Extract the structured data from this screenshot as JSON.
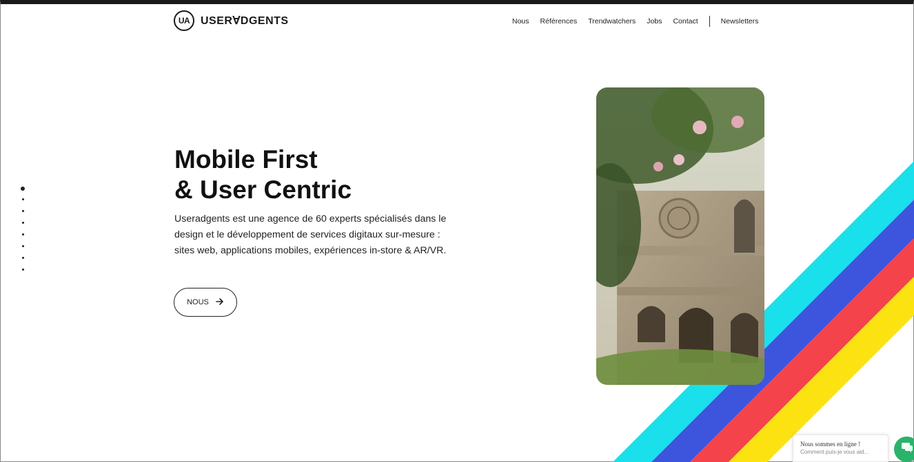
{
  "header": {
    "logo_mark": "UA",
    "logo_text": "USERⱯDGENTS",
    "nav": [
      {
        "label": "Nous"
      },
      {
        "label": "Références"
      },
      {
        "label": "Trendwatchers"
      },
      {
        "label": "Jobs"
      },
      {
        "label": "Contact"
      }
    ],
    "nav_extra": "Newsletters"
  },
  "hero": {
    "title_line1": "Mobile First",
    "title_line2": "& User Centric",
    "description": "Useradgents est une agence de 60 experts spécialisés dans le design et le développement de services digitaux sur-mesure : sites web, applications mobiles, expériences in-store & AR/VR.",
    "cta_label": "NOUS",
    "cta_icon": "arrow-right-icon"
  },
  "pager": {
    "count": 8,
    "active_index": 0
  },
  "stripes": {
    "colors": [
      "#19e0ea",
      "#3d55dd",
      "#f5434c",
      "#fde212"
    ]
  },
  "photo": {
    "subject": "church-facade-photo"
  },
  "chat": {
    "title": "Nous sommes en ligne !",
    "subtitle": "Comment puis-je vous aid...",
    "button_color": "#2bb26b",
    "icon": "chat-icon"
  }
}
